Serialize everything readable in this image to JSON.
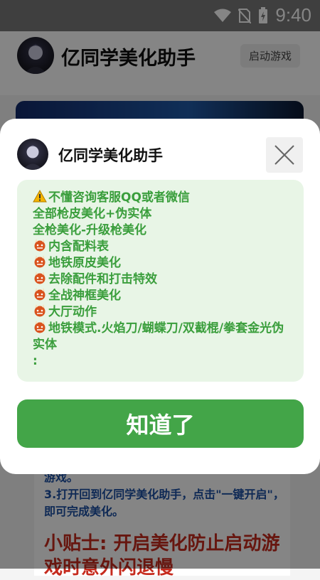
{
  "status_bar": {
    "time": "9:40",
    "icons": [
      "wifi-icon",
      "no-sim-icon",
      "battery-charging-icon"
    ]
  },
  "header": {
    "title": "亿同学美化助手",
    "launch_label": "启动游戏"
  },
  "background": {
    "step_text": "游戏。\n3.打开回到亿同学美化助手，点击\"一键开启\"，即可完成美化。",
    "tip_text": "小贴士: 开启美化防止启动游戏时意外闪退慢"
  },
  "dialog": {
    "title": "亿同学美化助手",
    "lines": [
      {
        "icon": "warning",
        "text": "不懂咨询客服QQ或者微信"
      },
      {
        "icon": "",
        "text": "全部枪皮美化+伪实体"
      },
      {
        "icon": "",
        "text": "全枪美化-升级枪美化"
      },
      {
        "icon": "ogre",
        "text": "内含配料表"
      },
      {
        "icon": "ogre",
        "text": "地铁原皮美化"
      },
      {
        "icon": "ogre",
        "text": "去除配件和打击特效"
      },
      {
        "icon": "ogre",
        "text": "全战神框美化"
      },
      {
        "icon": "ogre",
        "text": "大厅动作"
      },
      {
        "icon": "ogre",
        "text": "地铁模式.火焰刀/蝴蝶刀/双截棍/拳套金光伪实体"
      },
      {
        "icon": "",
        "text": ":"
      }
    ],
    "confirm_label": "知道了"
  },
  "colors": {
    "accent": "#43a548",
    "notice_bg": "#e8f5e6",
    "notice_text": "#3a9e3c"
  }
}
